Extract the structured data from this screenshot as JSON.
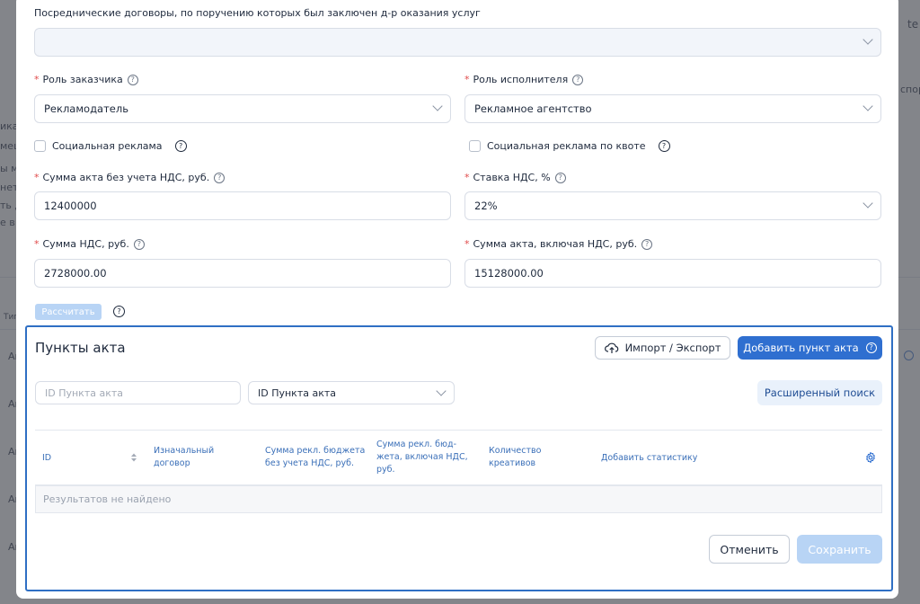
{
  "background": {
    "top_right_text": "te",
    "right_col_text": "спор",
    "left_texts": [
      "ика",
      "меш",
      "ы мо",
      "нета",
      "ть да",
      "е в р"
    ],
    "left_table_header": "Тип",
    "left_rows": [
      "Ак",
      "Ак",
      "Ак",
      "Ак",
      "Ак"
    ]
  },
  "modal": {
    "intermediary_label": "Посреднические договоры, по поручению которых был заключен д-р оказания услуг",
    "intermediary_value": "",
    "customer_role": {
      "label": "Роль заказчика",
      "value": "Рекламодатель"
    },
    "executor_role": {
      "label": "Роль исполнителя",
      "value": "Рекламное агентство"
    },
    "social_ad_label": "Социальная реклама",
    "social_ad_quota_label": "Социальная реклама по квоте",
    "amount_no_vat": {
      "label": "Сумма акта без учета НДС, руб.",
      "value": "12400000"
    },
    "vat_rate": {
      "label": "Ставка НДС, %",
      "value": "22%"
    },
    "vat_amount": {
      "label": "Сумма НДС, руб.",
      "value": "2728000.00"
    },
    "amount_with_vat": {
      "label": "Сумма акта, включая НДС, руб.",
      "value": "15128000.00"
    },
    "calculate_label": "Рассчитать",
    "required_mark": "*",
    "help_glyph": "?"
  },
  "acts": {
    "title": "Пункты акта",
    "import_export_label": "Импорт / Экспорт",
    "add_item_label": "Добавить пункт акта",
    "search_placeholder": "ID Пункта акта",
    "search_type_value": "ID Пункта акта",
    "advanced_search_label": "Расширенный поиск",
    "columns": [
      "ID",
      "Изначальный договор",
      "Сумма рекл. бюджета без учета НДС, руб.",
      "Сумма рекл. бюд-жета, включая НДС, руб.",
      "Количество креативов",
      "Добавить статистику"
    ],
    "empty_text": "Результатов не найдено",
    "cancel_label": "Отменить",
    "save_label": "Сохранить"
  }
}
